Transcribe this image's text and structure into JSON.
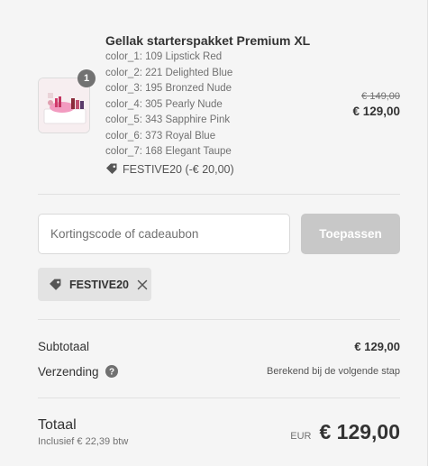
{
  "product": {
    "title": "Gellak starterspakket Premium XL",
    "quantity": "1",
    "variants": [
      "color_1: 109 Lipstick Red",
      "color_2: 221 Delighted Blue",
      "color_3: 195 Bronzed Nude",
      "color_4: 305 Pearly Nude",
      "color_5: 343 Sapphire Pink",
      "color_6: 373 Royal Blue",
      "color_7: 168 Elegant Taupe"
    ],
    "discount_applied": "FESTIVE20 (-€ 20,00)",
    "original_price": "€ 149,00",
    "price": "€ 129,00",
    "image_icon": "product-thumbnail"
  },
  "discount_form": {
    "placeholder": "Kortingscode of cadeaubon",
    "value": "",
    "apply_label": "Toepassen"
  },
  "applied_code": {
    "code": "FESTIVE20",
    "icon": "tag-icon",
    "remove_icon": "close-icon"
  },
  "summary": {
    "subtotal_label": "Subtotaal",
    "subtotal_value": "€ 129,00",
    "shipping_label": "Verzending",
    "shipping_value": "Berekend bij de volgende stap",
    "total_label": "Totaal",
    "tax_note": "Inclusief € 22,39 btw",
    "currency": "EUR",
    "total_value": "€ 129,00"
  },
  "colors": {
    "background": "#f5f5f5",
    "text": "#333333",
    "muted": "#717171",
    "button_disabled": "#c8c8c8",
    "chip_background": "#e3e3e3",
    "badge": "#727272"
  }
}
